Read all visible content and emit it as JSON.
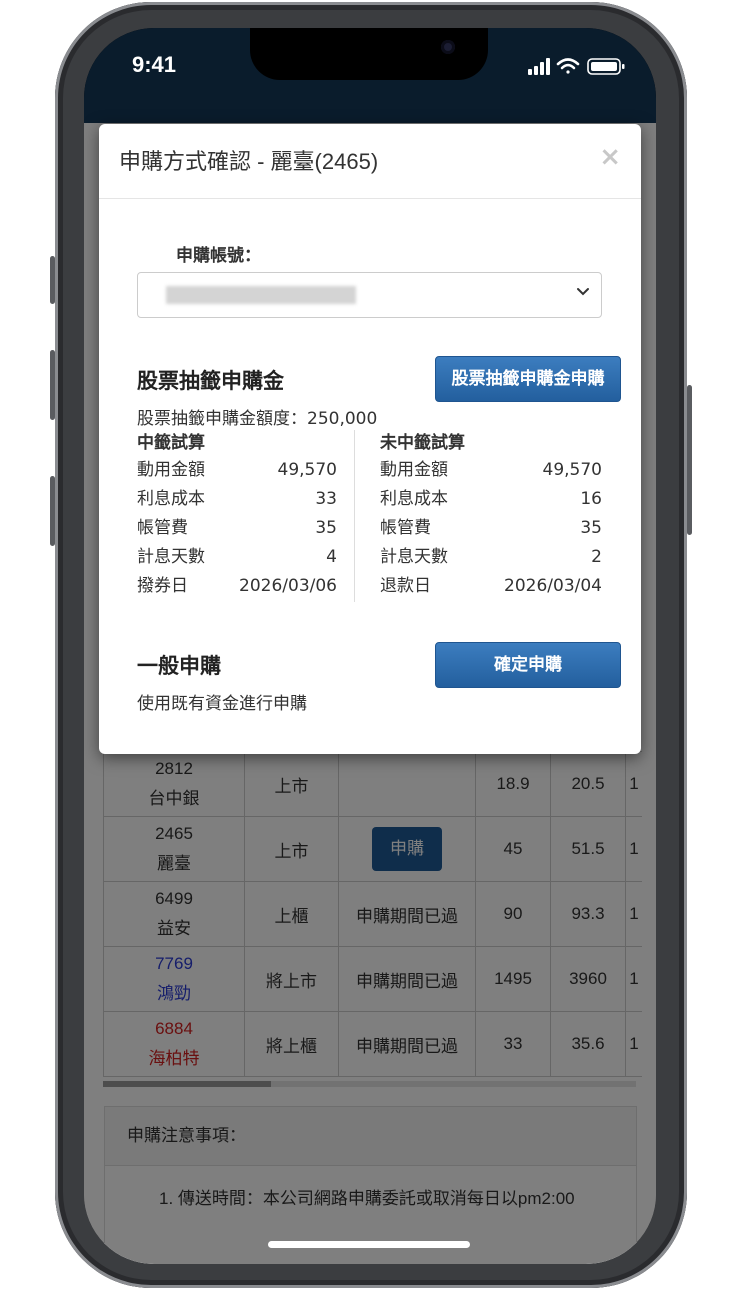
{
  "status_bar": {
    "time": "9:41"
  },
  "modal": {
    "title": "申購方式確認 - 麗臺(2465)",
    "close": "×",
    "account_label": "申購帳號：",
    "lottery": {
      "title": "股票抽籤申購金",
      "button": "股票抽籤申購金申購",
      "quota_label": "股票抽籤申購金額度：250,000",
      "win": {
        "heading": "中籤試算",
        "rows": [
          {
            "label": "動用金額",
            "value": "49,570"
          },
          {
            "label": "利息成本",
            "value": "33"
          },
          {
            "label": "帳管費",
            "value": "35"
          },
          {
            "label": "計息天數",
            "value": "4"
          },
          {
            "label": "撥券日",
            "value": "2026/03/06"
          }
        ]
      },
      "lose": {
        "heading": "未中籤試算",
        "rows": [
          {
            "label": "動用金額",
            "value": "49,570"
          },
          {
            "label": "利息成本",
            "value": "16"
          },
          {
            "label": "帳管費",
            "value": "35"
          },
          {
            "label": "計息天數",
            "value": "2"
          },
          {
            "label": "退款日",
            "value": "2026/03/04"
          }
        ]
      }
    },
    "general": {
      "title": "一般申購",
      "button": "確定申購",
      "description": "使用既有資金進行申購"
    }
  },
  "table": {
    "rows": [
      {
        "code": "2812",
        "name": "台中銀",
        "market": "上市",
        "status": "",
        "price": "18.9",
        "market_price": "20.5",
        "extra": "1",
        "color": "#333333"
      },
      {
        "code": "2465",
        "name": "麗臺",
        "market": "上市",
        "status": "申購",
        "price": "45",
        "market_price": "51.5",
        "extra": "1",
        "color": "#333333"
      },
      {
        "code": "6499",
        "name": "益安",
        "market": "上櫃",
        "status": "申購期間已過",
        "price": "90",
        "market_price": "93.3",
        "extra": "1",
        "color": "#333333"
      },
      {
        "code": "7769",
        "name": "鴻勁",
        "market": "將上市",
        "status": "申購期間已過",
        "price": "1495",
        "market_price": "3960",
        "extra": "1",
        "color": "#2b3bd6"
      },
      {
        "code": "6884",
        "name": "海柏特",
        "market": "將上櫃",
        "status": "申購期間已過",
        "price": "33",
        "market_price": "35.6",
        "extra": "1",
        "color": "#d42020"
      }
    ]
  },
  "notice": {
    "title": "申購注意事項：",
    "line1": "1. 傳送時間：本公司網路申購委託或取消每日以pm2:00"
  }
}
